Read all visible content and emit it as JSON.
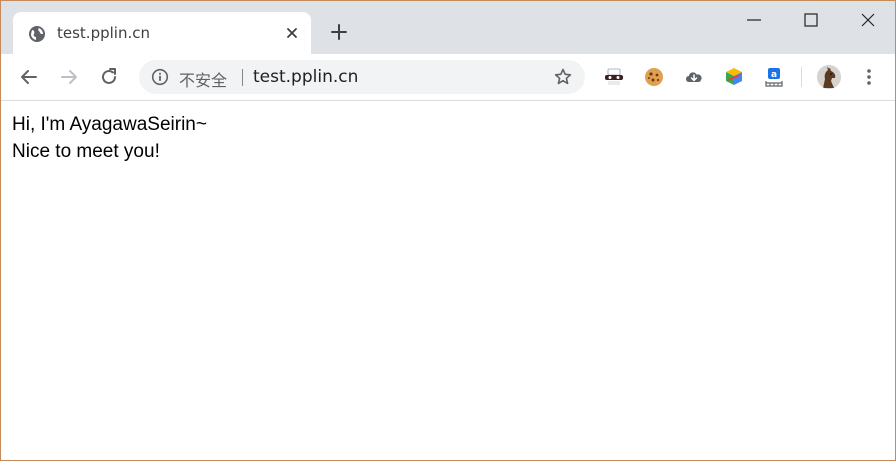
{
  "browser": {
    "tab": {
      "title": "test.pplin.cn",
      "favicon": "globe-icon"
    },
    "window_controls": [
      "minimize-icon",
      "maximize-icon",
      "close-icon"
    ],
    "toolbar": {
      "nav_icons": [
        "back-arrow-icon",
        "forward-arrow-icon",
        "reload-icon"
      ],
      "omnibox": {
        "security_label": "不安全",
        "url": "test.pplin.cn"
      },
      "extensions": [
        "incognito-mask-icon",
        "cookie-icon",
        "cloud-download-icon",
        "colorful-cube-icon",
        "translate-icon"
      ],
      "profile_avatar": "horse-avatar",
      "menu_icon": "more-vertical-icon"
    }
  },
  "page": {
    "line1": "Hi, I'm AyagawaSeirin~",
    "line2": "Nice to meet you!"
  },
  "colors": {
    "tabstrip_bg": "#dee1e6",
    "omnibox_bg": "#f1f3f4",
    "window_border": "#c58a5c",
    "icon_gray": "#5f6368"
  }
}
